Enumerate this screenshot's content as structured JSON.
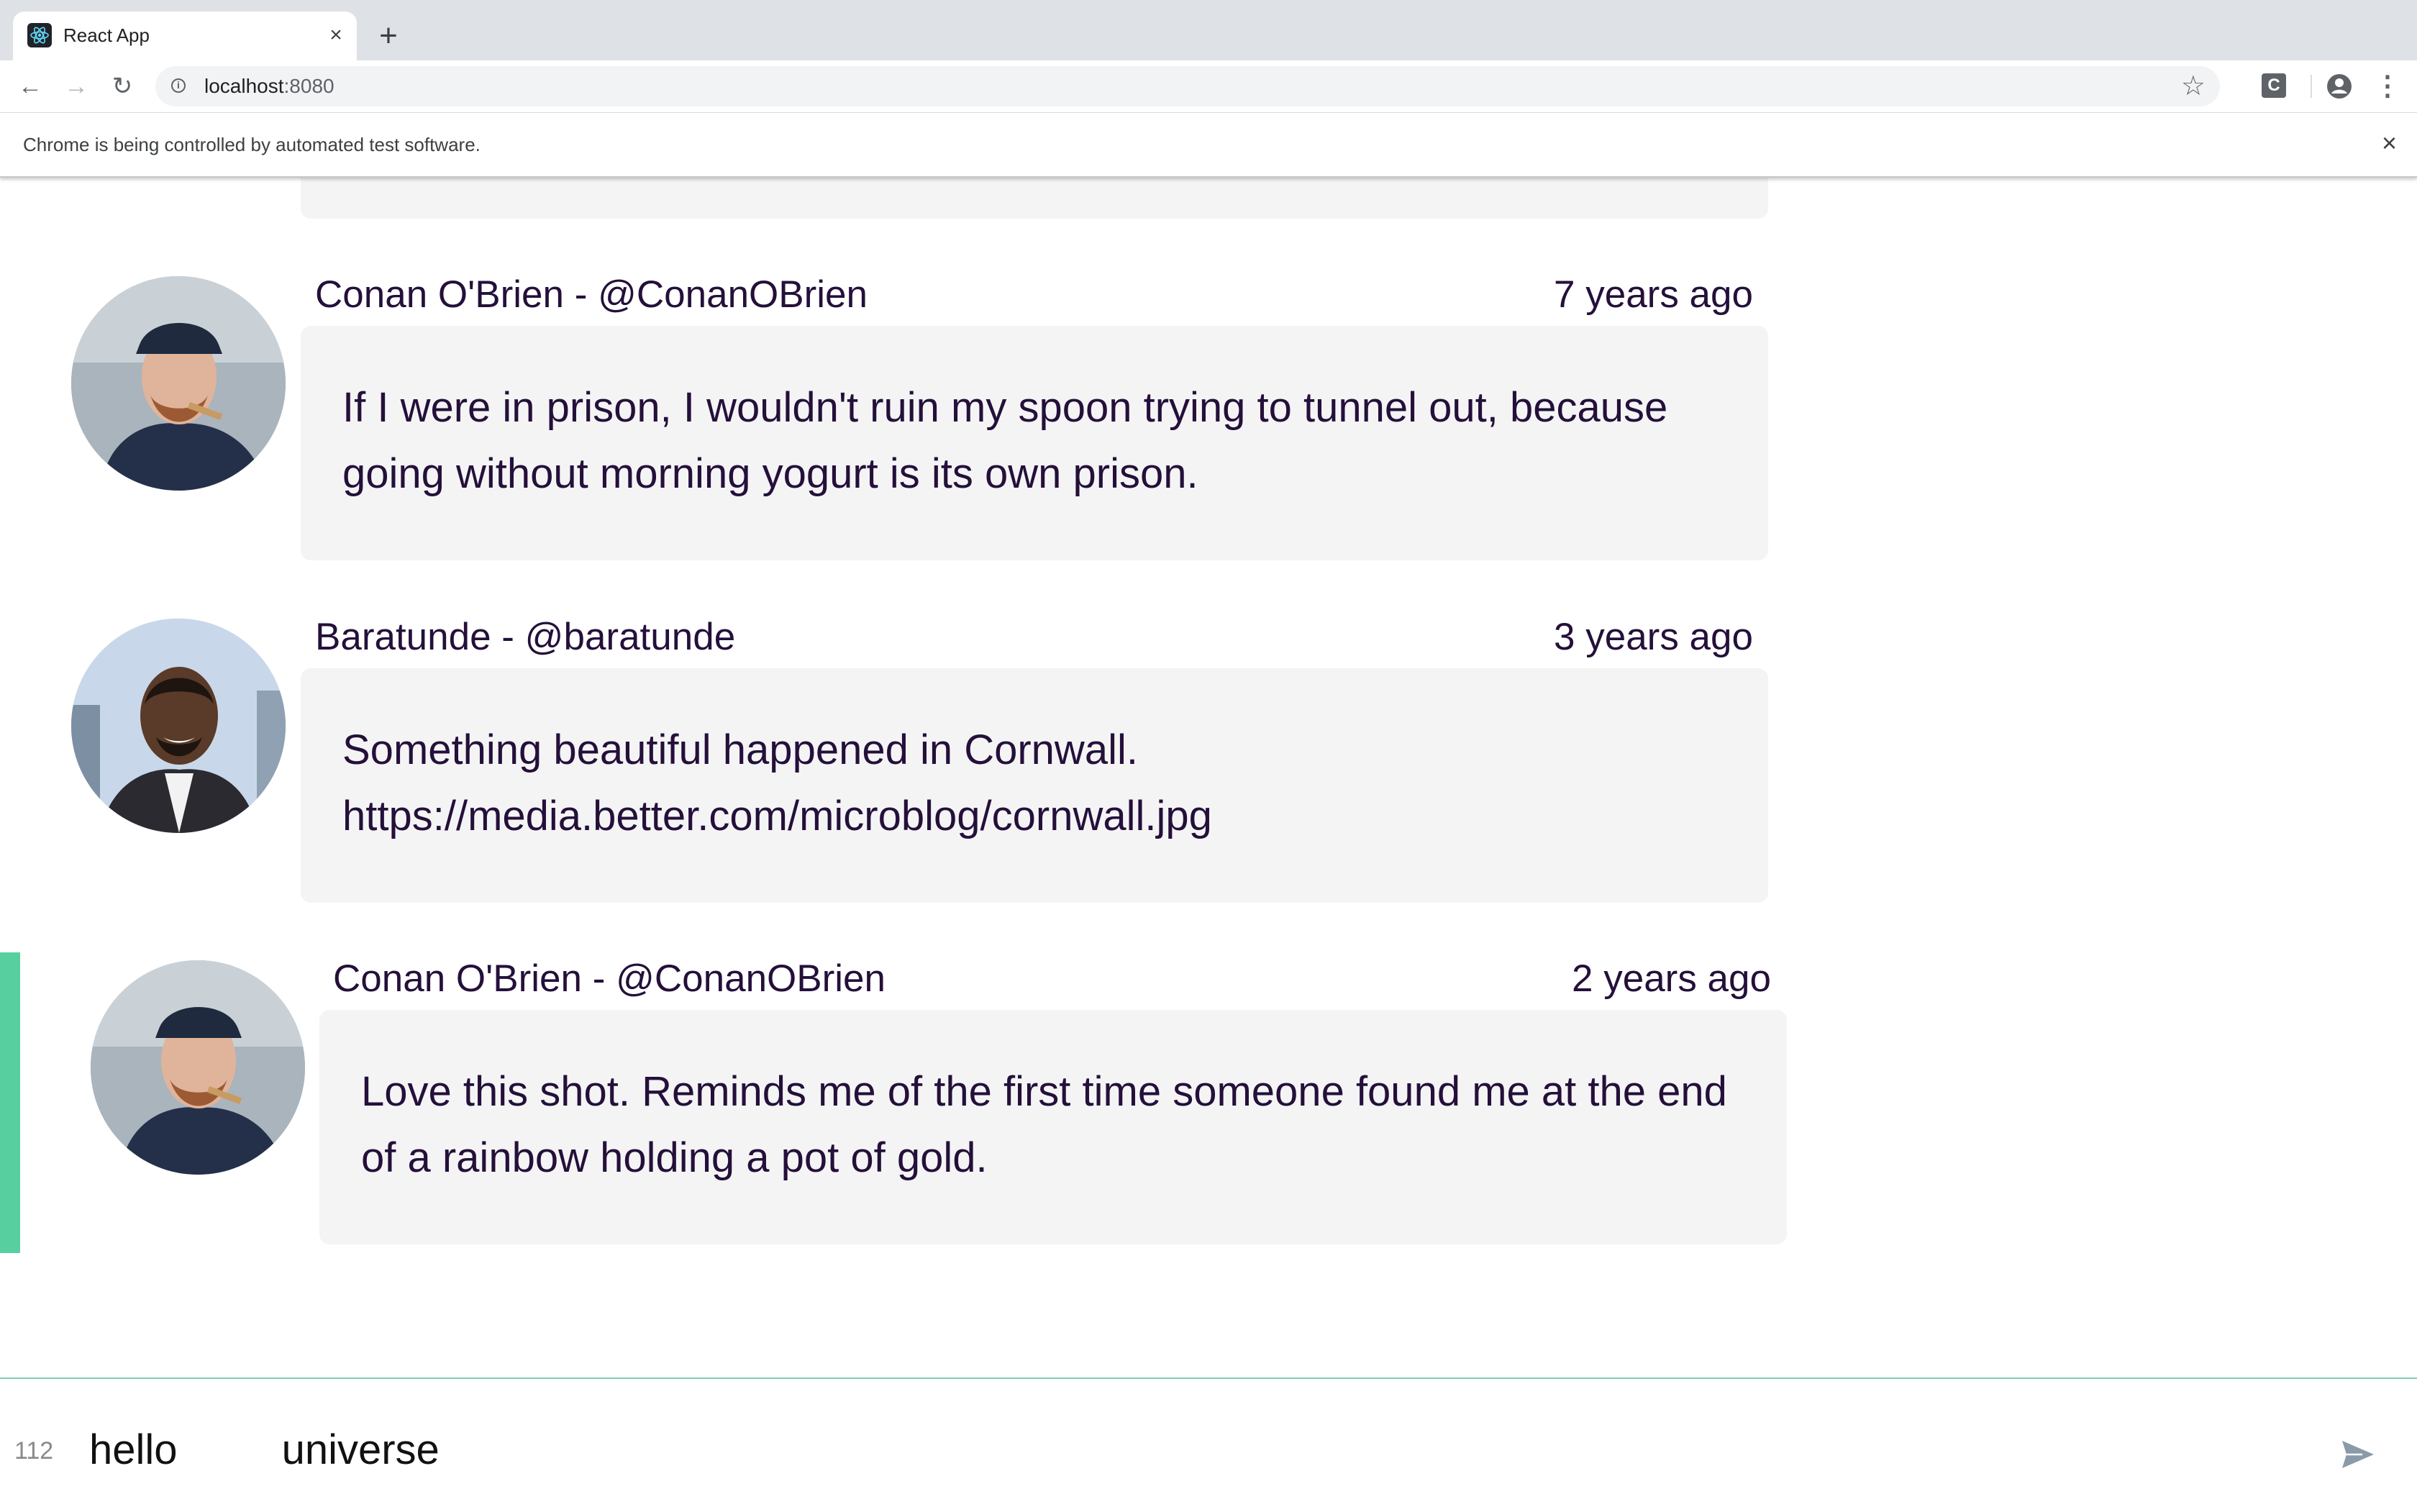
{
  "browser": {
    "tab_title": "React App",
    "tab_close": "×",
    "new_tab": "+",
    "url_host": "localhost",
    "url_port": ":8080",
    "extension_letter": "C",
    "infobar_text": "Chrome is being controlled by automated test software.",
    "infobar_close": "×",
    "icons": [
      "back-icon",
      "forward-icon",
      "reload-icon",
      "info-icon",
      "star-icon",
      "extension-icon",
      "profile-icon",
      "menu-icon"
    ]
  },
  "posts": [
    {
      "author": "Conan O'Brien - @ConanOBrien",
      "time": "7 years ago",
      "body": "If I were in prison, I wouldn't ruin my spoon trying to tunnel out, because going without morning yogurt is its own prison.",
      "selected": false
    },
    {
      "author": "Baratunde - @baratunde",
      "time": "3 years ago",
      "body": "Something beautiful happened in Cornwall. https://media.better.com/microblog/cornwall.jpg",
      "selected": false
    },
    {
      "author": "Conan O'Brien - @ConanOBrien",
      "time": "2 years ago",
      "body": "Love this shot. Reminds me of the first time someone found me at the end of a rainbow holding a pot of gold.",
      "selected": true
    }
  ],
  "composer": {
    "char_count": "112",
    "text": "hello         universe",
    "send_icon": "send-icon"
  },
  "colors": {
    "selected_accent": "#57cf9e",
    "card_background": "#f4f4f5",
    "text": "#24103a"
  }
}
